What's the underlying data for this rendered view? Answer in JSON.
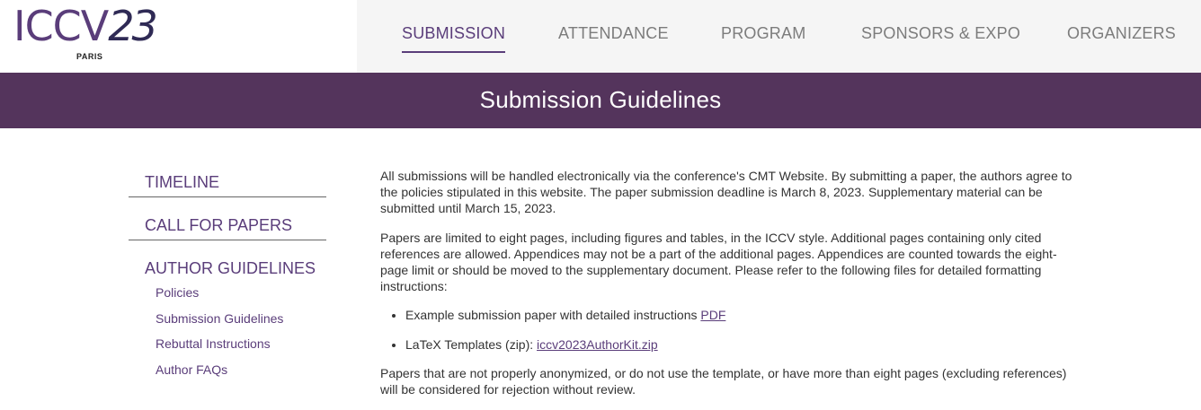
{
  "header": {
    "logo": {
      "main": "ICCV",
      "year": "23",
      "sub": "PARIS"
    },
    "nav": [
      {
        "label": "SUBMISSION",
        "active": true
      },
      {
        "label": "ATTENDANCE",
        "active": false
      },
      {
        "label": "PROGRAM",
        "active": false
      },
      {
        "label": "SPONSORS & EXPO",
        "active": false
      },
      {
        "label": "ORGANIZERS",
        "active": false
      }
    ]
  },
  "banner": {
    "title": "Submission Guidelines"
  },
  "sidebar": {
    "sections": [
      {
        "label": "TIMELINE"
      },
      {
        "label": "CALL FOR PAPERS"
      },
      {
        "label": "AUTHOR GUIDELINES",
        "links": [
          "Policies",
          "Submission Guidelines",
          "Rebuttal Instructions",
          "Author FAQs"
        ]
      }
    ]
  },
  "main": {
    "p1": "All submissions will be handled electronically via the conference's CMT Website. By submitting a paper, the authors agree to the policies stipulated in this website. The paper submission deadline is March 8, 2023. Supplementary material can be submitted until March 15, 2023.",
    "p2": "Papers are limited to eight pages, including figures and tables, in the ICCV style. Additional pages containing only cited references are allowed. Appendices may not be a part of the additional pages. Appendices are counted towards the eight-page limit or should be moved to the supplementary document. Please refer to the following files for detailed formatting instructions:",
    "bullets": [
      {
        "text": "Example submission paper with detailed instructions ",
        "link": "PDF"
      },
      {
        "text": "LaTeX Templates (zip): ",
        "link": "iccv2023AuthorKit.zip"
      }
    ],
    "p3": "Papers that are not properly anonymized, or do not use the template, or have more than eight pages (excluding references) will be considered for rejection without review."
  },
  "colors": {
    "accent": "#5a3d7a",
    "banner": "#54345c",
    "nav_bg": "#f5f5f5",
    "text": "#333333"
  }
}
